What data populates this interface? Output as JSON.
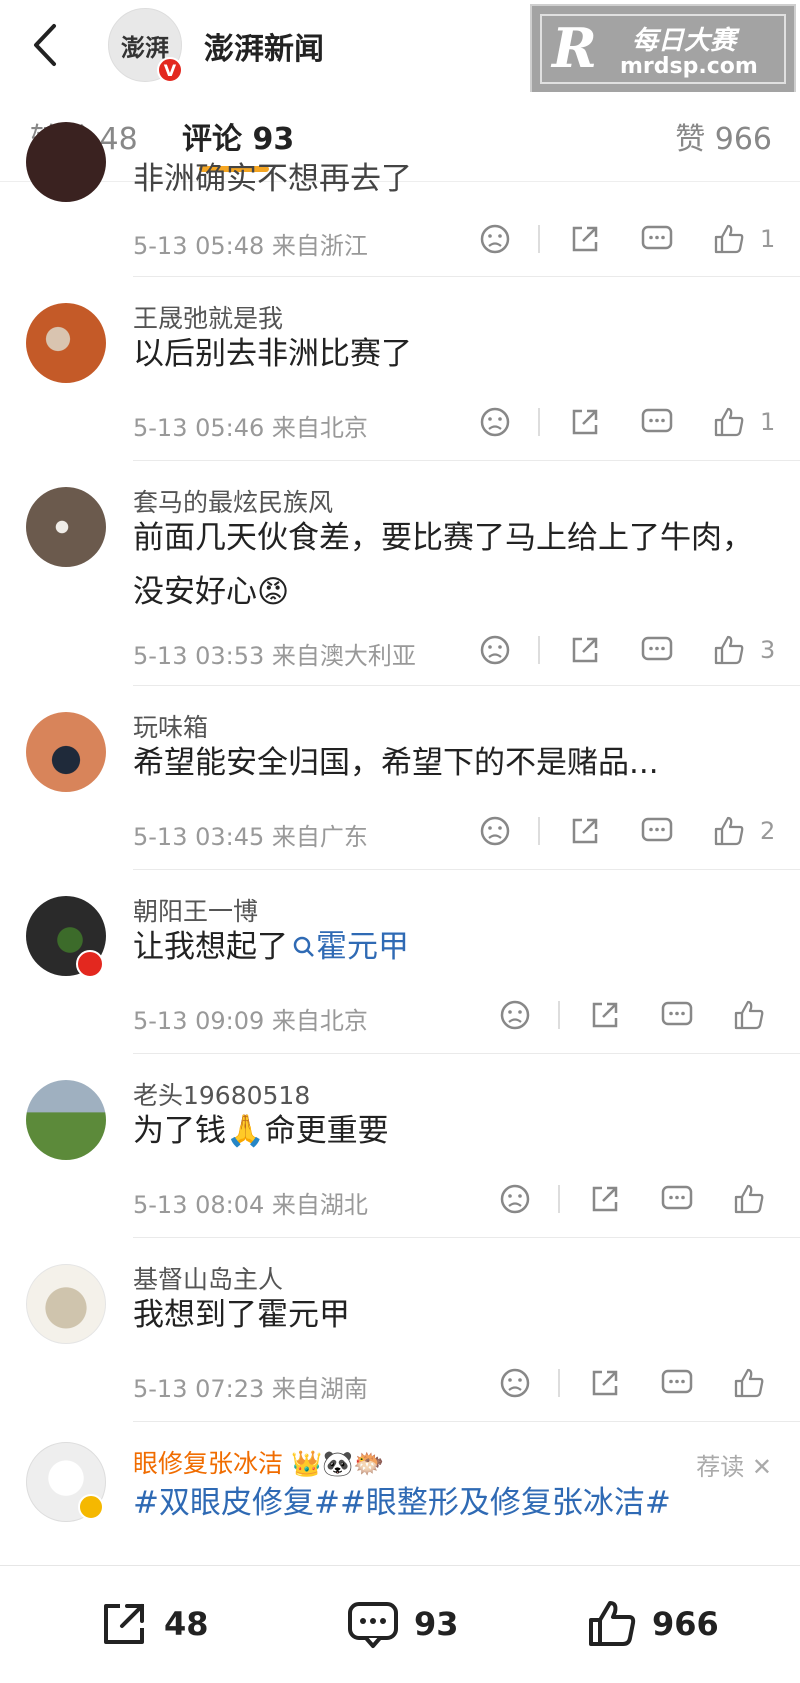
{
  "header": {
    "channel_name": "澎湃新闻",
    "logo_text": "澎湃",
    "verified_badge": "V",
    "watermark_cn": "每日大赛",
    "watermark_url": "mrdsp.com",
    "watermark_letter": "R"
  },
  "tabs": [
    {
      "label": "转发 48"
    },
    {
      "label": "评论 93"
    },
    {
      "label": "赞 966"
    }
  ],
  "comments": [
    {
      "username": "",
      "text": "非洲确实不想再去了",
      "meta": "5-13 05:48 来自浙江",
      "likes": "1"
    },
    {
      "username": "王晟弛就是我",
      "text": "以后别去非洲比赛了",
      "meta": "5-13 05:46 来自北京",
      "likes": "1"
    },
    {
      "username": "套马的最炫民族风",
      "text": "前面几天伙食差，要比赛了马上给上了牛肉，",
      "text2": "没安好心😡",
      "meta": "5-13 03:53 来自澳大利亚",
      "likes": "3"
    },
    {
      "username": "玩味箱",
      "text": "希望能安全归国，希望下的不是赌品...",
      "meta": "5-13 03:45 来自广东",
      "likes": "2"
    },
    {
      "username": "朝阳王一博",
      "text": "让我想起了",
      "link": "霍元甲",
      "meta": "5-13 09:09 来自北京",
      "likes": ""
    },
    {
      "username": "老头19680518",
      "text": "为了钱🙏命更重要",
      "meta": "5-13 08:04 来自湖北",
      "likes": ""
    },
    {
      "username": "基督山岛主人",
      "text": "我想到了霍元甲",
      "meta": "5-13 07:23 来自湖南",
      "likes": ""
    }
  ],
  "promo": {
    "username": "眼修复张冰洁 👑🐼🐡",
    "text": "#双眼皮修复##眼整形及修复张冰洁#",
    "tag": "荐读 ✕"
  },
  "bottom": {
    "repost_count": "48",
    "comment_count": "93",
    "like_count": "966"
  },
  "colors": {
    "accent_tab": "#f5a623",
    "link_blue": "#2f6ab4",
    "vip_orange": "#f06c00",
    "verified_red": "#e3281f"
  }
}
